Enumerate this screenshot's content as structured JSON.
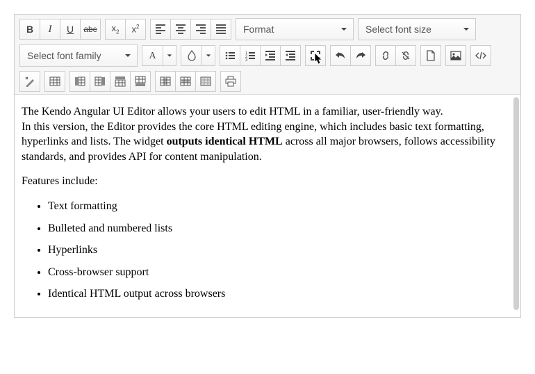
{
  "toolbar": {
    "format_placeholder": "Format",
    "fontsize_placeholder": "Select font size",
    "fontfamily_placeholder": "Select font family",
    "bold": "B",
    "italic": "I",
    "underline": "U",
    "strike": "abc",
    "sub": "x",
    "sub2": "2",
    "sup": "x",
    "sup2": "2",
    "fontcolor": "A"
  },
  "content": {
    "p1a": "The Kendo Angular UI Editor allows your users to edit HTML in a familiar, user-friendly way.",
    "p1b": "In this version, the Editor provides the core HTML editing engine, which includes basic text formatting, hyperlinks and lists. The widget ",
    "p1bold": "outputs identical HTML",
    "p1c": " across all major browsers, follows accessibility standards, and provides API for content manipulation.",
    "p2": "Features include:",
    "items": [
      "Text formatting",
      "Bulleted and numbered lists",
      "Hyperlinks",
      "Cross-browser support",
      "Identical HTML output across browsers"
    ]
  }
}
